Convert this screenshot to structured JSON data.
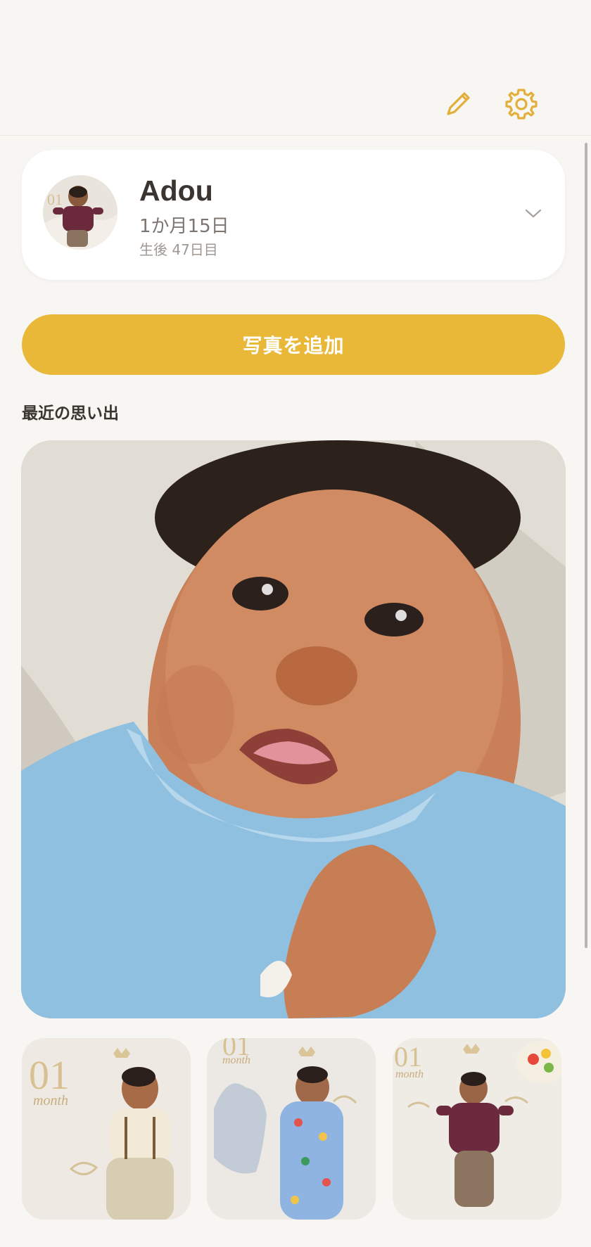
{
  "profile": {
    "name": "Adou",
    "age": "1か月15日",
    "days": "生後 47日目"
  },
  "actions": {
    "add_photo_label": "写真を追加"
  },
  "section": {
    "recent_title": "最近の思い出"
  },
  "thumbnails": [
    {
      "label_big": "01",
      "label_small": "month"
    },
    {
      "label_big": "01",
      "label_small": "month"
    },
    {
      "label_big": "01",
      "label_small": "month"
    }
  ],
  "icons": {
    "edit": "pencil-icon",
    "settings": "gear-icon",
    "expand": "chevron-down-icon"
  },
  "colors": {
    "accent": "#e9b838",
    "background": "#f8f6f2",
    "card": "#ffffff",
    "text": "#3b3531"
  }
}
